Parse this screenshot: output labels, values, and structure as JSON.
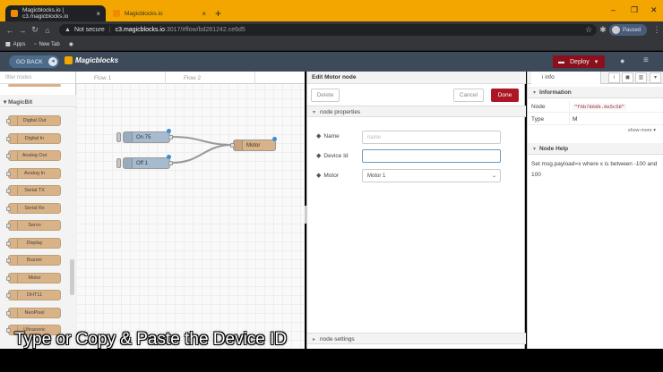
{
  "browser": {
    "tabs": [
      {
        "title": "Magicblocks.io | c3.magicblocks.io"
      },
      {
        "title": "Magicblocks.io"
      }
    ],
    "new_tab": "+",
    "window_controls": [
      "–",
      "❐",
      "✕"
    ],
    "address": {
      "security": "Not secure",
      "host": "c3.magicblocks.io",
      "path": ":3017/#flow/bd281242.ce6d5"
    },
    "profile": "Paused",
    "bookmarks": [
      "Apps",
      "New Tab"
    ]
  },
  "app": {
    "go_back": "GO BACK",
    "logo": "Magicblocks",
    "deploy": "Deploy"
  },
  "palette": {
    "filter_placeholder": "filter nodes",
    "category": "MagicBit",
    "nodes": [
      "Digital Out",
      "Digital In",
      "Analog Out",
      "Analog In",
      "Serial TX",
      "Serial Rx",
      "Servo",
      "Display",
      "Buzzer",
      "Motor",
      "DHT11",
      "NeoPixel",
      "Ultrasonic"
    ]
  },
  "workspace": {
    "tabs": [
      "Flow 1",
      "Flow 2"
    ],
    "nodes": {
      "inject1": "On 75",
      "inject2": "Off 1",
      "motor": "Motor"
    }
  },
  "editor": {
    "title": "Edit Motor node",
    "delete": "Delete",
    "cancel": "Cancel",
    "done": "Done",
    "section_properties": "node properties",
    "section_settings": "node settings",
    "fields": {
      "name_label": "Name",
      "name_placeholder": "name",
      "device_label": "Device Id",
      "device_value": "",
      "motor_label": "Motor",
      "motor_value": "Motor 1"
    }
  },
  "sidebar": {
    "tab": "info",
    "info_header": "Information",
    "rows": [
      {
        "key": "Node",
        "value": "\"f6b7868b.0e5c58\""
      },
      {
        "key": "Type",
        "value": "M"
      }
    ],
    "show_more": "show more ▾",
    "help_header": "Node Help",
    "help_text": "Set msg.payload=x where x is between -100 and 100"
  },
  "caption": "Type or Copy & Paste the Device ID",
  "colors": {
    "chrome_accent": "#f3a500",
    "header": "#3d4a5a",
    "deploy": "#8c101c",
    "done": "#ad1625",
    "node_tan": "#d9b287",
    "inject_blue": "#a6bbcf"
  }
}
